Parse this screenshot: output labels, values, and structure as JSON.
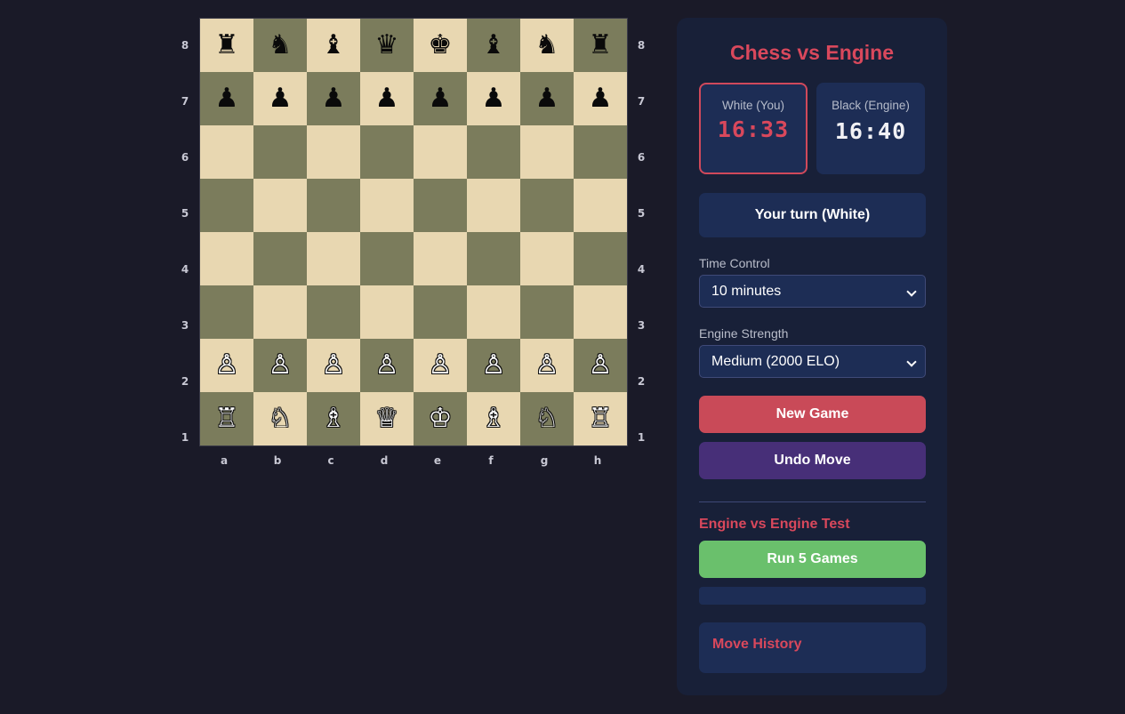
{
  "board": {
    "files": [
      "a",
      "b",
      "c",
      "d",
      "e",
      "f",
      "g",
      "h"
    ],
    "ranks": [
      "8",
      "7",
      "6",
      "5",
      "4",
      "3",
      "2",
      "1"
    ],
    "position": [
      [
        "♜",
        "♞",
        "♝",
        "♛",
        "♚",
        "♝",
        "♞",
        "♜"
      ],
      [
        "♟",
        "♟",
        "♟",
        "♟",
        "♟",
        "♟",
        "♟",
        "♟"
      ],
      [
        "",
        "",
        "",
        "",
        "",
        "",
        "",
        ""
      ],
      [
        "",
        "",
        "",
        "",
        "",
        "",
        "",
        ""
      ],
      [
        "",
        "",
        "",
        "",
        "",
        "",
        "",
        ""
      ],
      [
        "",
        "",
        "",
        "",
        "",
        "",
        "",
        ""
      ],
      [
        "♙",
        "♙",
        "♙",
        "♙",
        "♙",
        "♙",
        "♙",
        "♙"
      ],
      [
        "♖",
        "♘",
        "♗",
        "♕",
        "♔",
        "♗",
        "♘",
        "♖"
      ]
    ],
    "light_square_color": "#e8d7b1",
    "dark_square_color": "#7b7c5c"
  },
  "panel": {
    "title": "Chess vs Engine",
    "white_clock": {
      "label": "White (You)",
      "time": "16:33"
    },
    "black_clock": {
      "label": "Black (Engine)",
      "time": "16:40"
    },
    "status": "Your turn (White)",
    "time_control": {
      "label": "Time Control",
      "selected": "10 minutes"
    },
    "engine_strength": {
      "label": "Engine Strength",
      "selected": "Medium (2000 ELO)"
    },
    "new_game_label": "New Game",
    "undo_label": "Undo Move",
    "engine_test": {
      "title": "Engine vs Engine Test",
      "run_label": "Run 5 Games"
    },
    "move_history": {
      "title": "Move History",
      "moves": []
    }
  },
  "colors": {
    "accent": "#d9485c",
    "background": "#1a1a28",
    "panel": "#182038",
    "card": "#1d2d55",
    "new_game": "#c94a58",
    "undo": "#472f78",
    "run": "#6ac06c"
  }
}
